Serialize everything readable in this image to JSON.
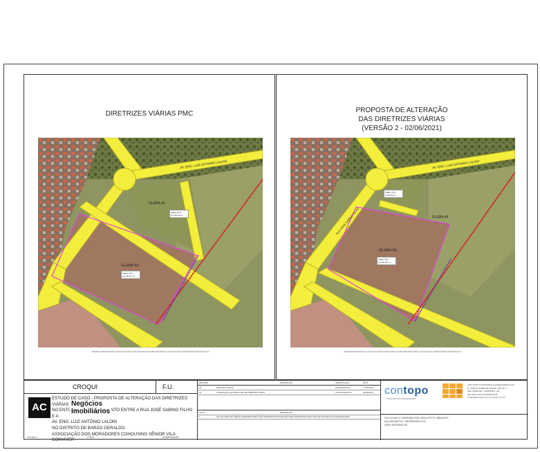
{
  "left_panel": {
    "title": "DIRETRIZES VIÁRIAS PMC",
    "labels": {
      "road": "AV. ENG. LUIZ ANTONIO LALONI",
      "gleba_top": "GLEBA 44",
      "gleba_bottom": "GLEBA 55",
      "area_top": "ÁREA ÚTIL 10.760,00 m²",
      "area_bottom": "ÁREA ÚTIL 32.160,00 m²"
    },
    "caption": "IMAGEM RETIRADA DO GOOGLE EARTH PRO DATA DA IMAGEM 06/04/2021 LOCALIZAÇÃO APROXIMADA SEM ESCALA"
  },
  "right_panel": {
    "title_lines": [
      "PROPOSTA DE ALTERAÇÃO",
      "DAS DIRETRIZES VIÁRIAS",
      "(VERSÃO 2 - 02/06/2021)"
    ],
    "labels": {
      "road": "AV. ENG. LUIZ ANTONIO LALONI",
      "side_road": "RUA JOSÉ SABINO FILHO",
      "gleba_top": "GLEBA 44",
      "gleba_bottom": "GLEBA 55",
      "area_top": "ÁREA ÚTIL 4.460,00 m²",
      "area_bottom": "ÁREA ÚTIL 32.460,00 m²"
    },
    "caption": "IMAGEM RETIRADA DO GOOGLE EARTH PRO DATA DA IMAGEM 06/04/2021 LOCALIZAÇÃO APROXIMADA SEM ESCALA"
  },
  "title_block": {
    "croqui": "CROQUI",
    "fu": "F.U.",
    "study_lines": [
      "ESTUDO DE CASO - PROPOSTA DE ALTERAÇÃO DAS DIRETRIZES VIÁRIAS",
      "NO ENTORNO DO CRUZAMENTO ENTRE A RUA JOSÉ SABINO FILHO E A",
      "AV. ENG. LUIZ ANTÔNIO LALONI",
      "NO DISTRITO DE BARÃO GERALDO",
      "ASSOCIAÇÃO DOS MORADORES COHOUSING SÊNIOR VILA CONVIVER"
    ],
    "logo_letters": "AC",
    "logo_name_lines": [
      "Negócios",
      "Imobiliários"
    ],
    "footer": {
      "folha": "FOLHA: 1",
      "escala": "1:7500",
      "municipio": "CAMPINAS/SP"
    }
  },
  "revision_table": {
    "headers": [
      "REVISÃO",
      "DESCRIÇÃO",
      "VERIFICAÇÃO",
      "DATA"
    ],
    "rows": [
      [
        "00",
        "EMISSÃO INICIAL",
        "RAQUIN/ROSA",
        "17/05/2021"
      ],
      [
        "01",
        "ALTERAÇÃO NA PROPOSTA DE DIRETRIZ VIÁRIA",
        "VALLIM MATTOS",
        "02/06/2021"
      ]
    ],
    "notes_headers": [
      "NOTA",
      "DESCRIÇÃO"
    ],
    "notes": [
      [
        "1",
        "OS VALORES DE ÁREAS APRESENTADOS NÃO APRESENTAM PRECISÃO RECOMENDADA PARA FINS DE PROJETOS DE ENGENHARIA"
      ]
    ]
  },
  "company": {
    "brand_a": "con",
    "brand_b": "topo",
    "tagline": "TOPOGRAFIA E ENGENHARIA",
    "address_lines": [
      "CON TOPO TOPOGRAFIA E ENGENHARIA LTDA",
      "R. JOSÉ ÁLVARES DE SOUSA, 380, Bl. 2",
      "CEP 13086-030 - CAMPINAS - SP",
      "(19) 3181-1563   (19) 99280-2075",
      "contato@contopo.com.br   contopo.com.br"
    ],
    "bottom_lines": [
      "EXECUTADO E CONFERIDO POR: ARQUITETO E URBANISTA",
      "WILLIAM MATTOS - ENGENHEIRO CIVIL",
      "CREA: 5063284411-SP"
    ]
  },
  "colors": {
    "road": "#f3ee3c",
    "road_edge": "#b8b22a",
    "lot_outline": "#e040e0",
    "red_line": "#d42020",
    "brand_blue": "#4a8fd0",
    "brand_orange": "#f3a833"
  }
}
